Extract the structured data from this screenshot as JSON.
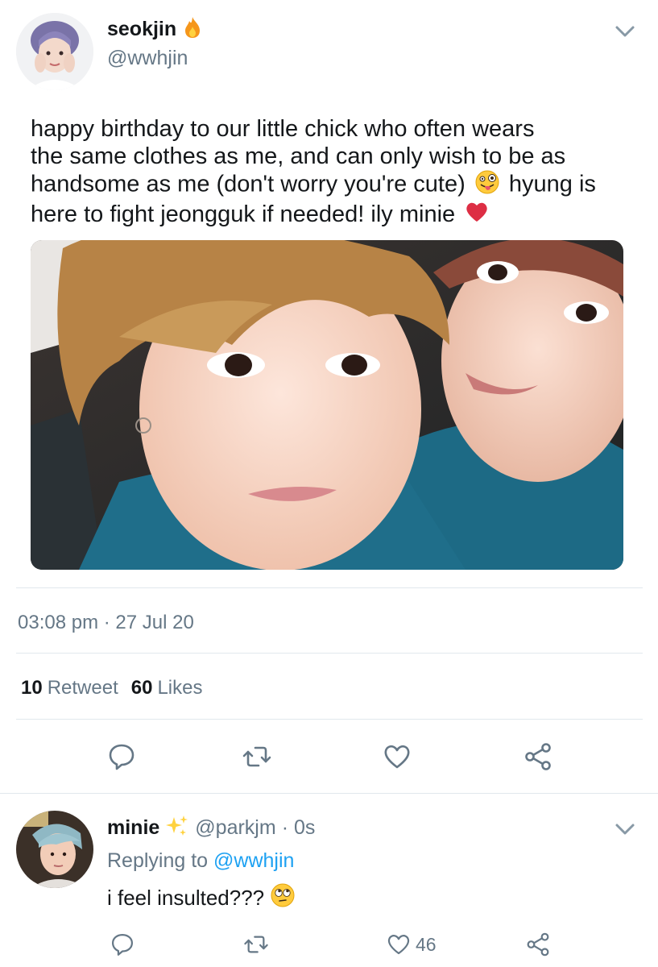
{
  "tweet": {
    "author_name": "seokjin",
    "author_name_emoji": "fire-emoji",
    "author_handle": "@wwhjin",
    "text_lines": [
      "happy birthday to our little chick who often wears",
      "the same clothes as me, and can only wish to be as",
      "handsome as me (don't worry you're cute)",
      "hyung is",
      "here to fight jeongguk if needed! ily minie"
    ],
    "inline_emojis": [
      "winking-tongue-emoji",
      "red-heart-emoji"
    ],
    "time": "03:08 pm",
    "separator": "·",
    "date": "27 Jul 20",
    "retweet_count": "10",
    "retweet_label": "Retweet",
    "like_count": "60",
    "like_label": "Likes",
    "actions": [
      "reply-icon",
      "retweet-icon",
      "like-icon",
      "share-icon"
    ]
  },
  "reply": {
    "author_name": "minie",
    "author_name_emoji": "sparkles-emoji",
    "author_handle": "@parkjm",
    "age": "0s",
    "separator": "·",
    "replying_to_label": "Replying to",
    "replying_to_handle": "@wwhjin",
    "text": "i feel insulted???",
    "text_emoji": "eye-roll-emoji",
    "like_count": "46",
    "actions": [
      "reply-icon",
      "retweet-icon",
      "like-icon",
      "share-icon"
    ]
  },
  "colors": {
    "text": "#14171a",
    "muted": "#657786",
    "link": "#1da1f2",
    "divider": "#e1e8ed",
    "shirt_teal": "#1d6a85"
  }
}
